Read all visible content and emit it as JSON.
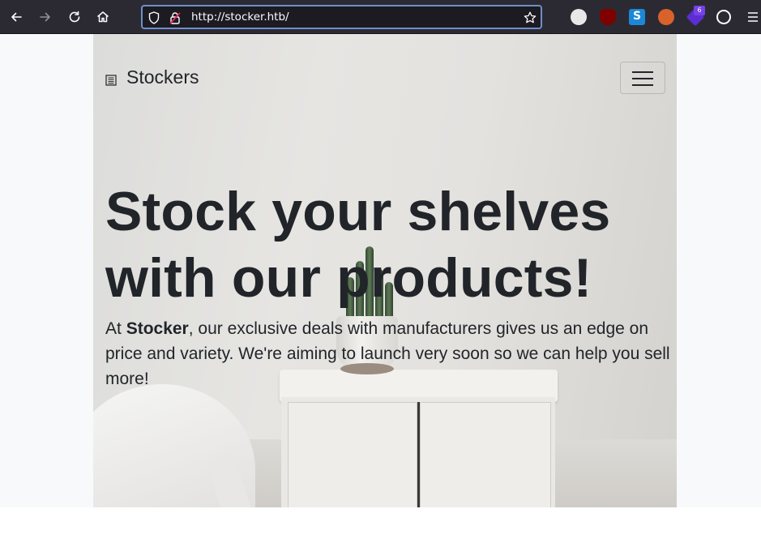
{
  "browser": {
    "url": "http://stocker.htb/",
    "extension_badge": "6",
    "icons": [
      "back-icon",
      "forward-icon",
      "reload-icon",
      "home-icon",
      "shield-icon",
      "insecure-lock-icon",
      "bookmark-star-icon",
      "hackbar-icon",
      "ublock-icon",
      "s-extension-icon",
      "foxyproxy-icon",
      "wappalyzer-icon",
      "cookie-icon",
      "menu-icon"
    ]
  },
  "page": {
    "brand": "Stockers",
    "headline_line1": "Stock your shelves",
    "headline_line2": "with our products!",
    "lead_prefix": "At ",
    "lead_bold": "Stocker",
    "lead_rest": ", our exclusive deals with manufacturers gives us an edge on price and variety. We're aiming to launch very soon so we can help you sell more!"
  },
  "colors": {
    "toolbar_bg": "#2b2a33",
    "url_focus_border": "#6f8fc8",
    "text_dark": "#212529",
    "page_bg": "#f8f9fa"
  }
}
